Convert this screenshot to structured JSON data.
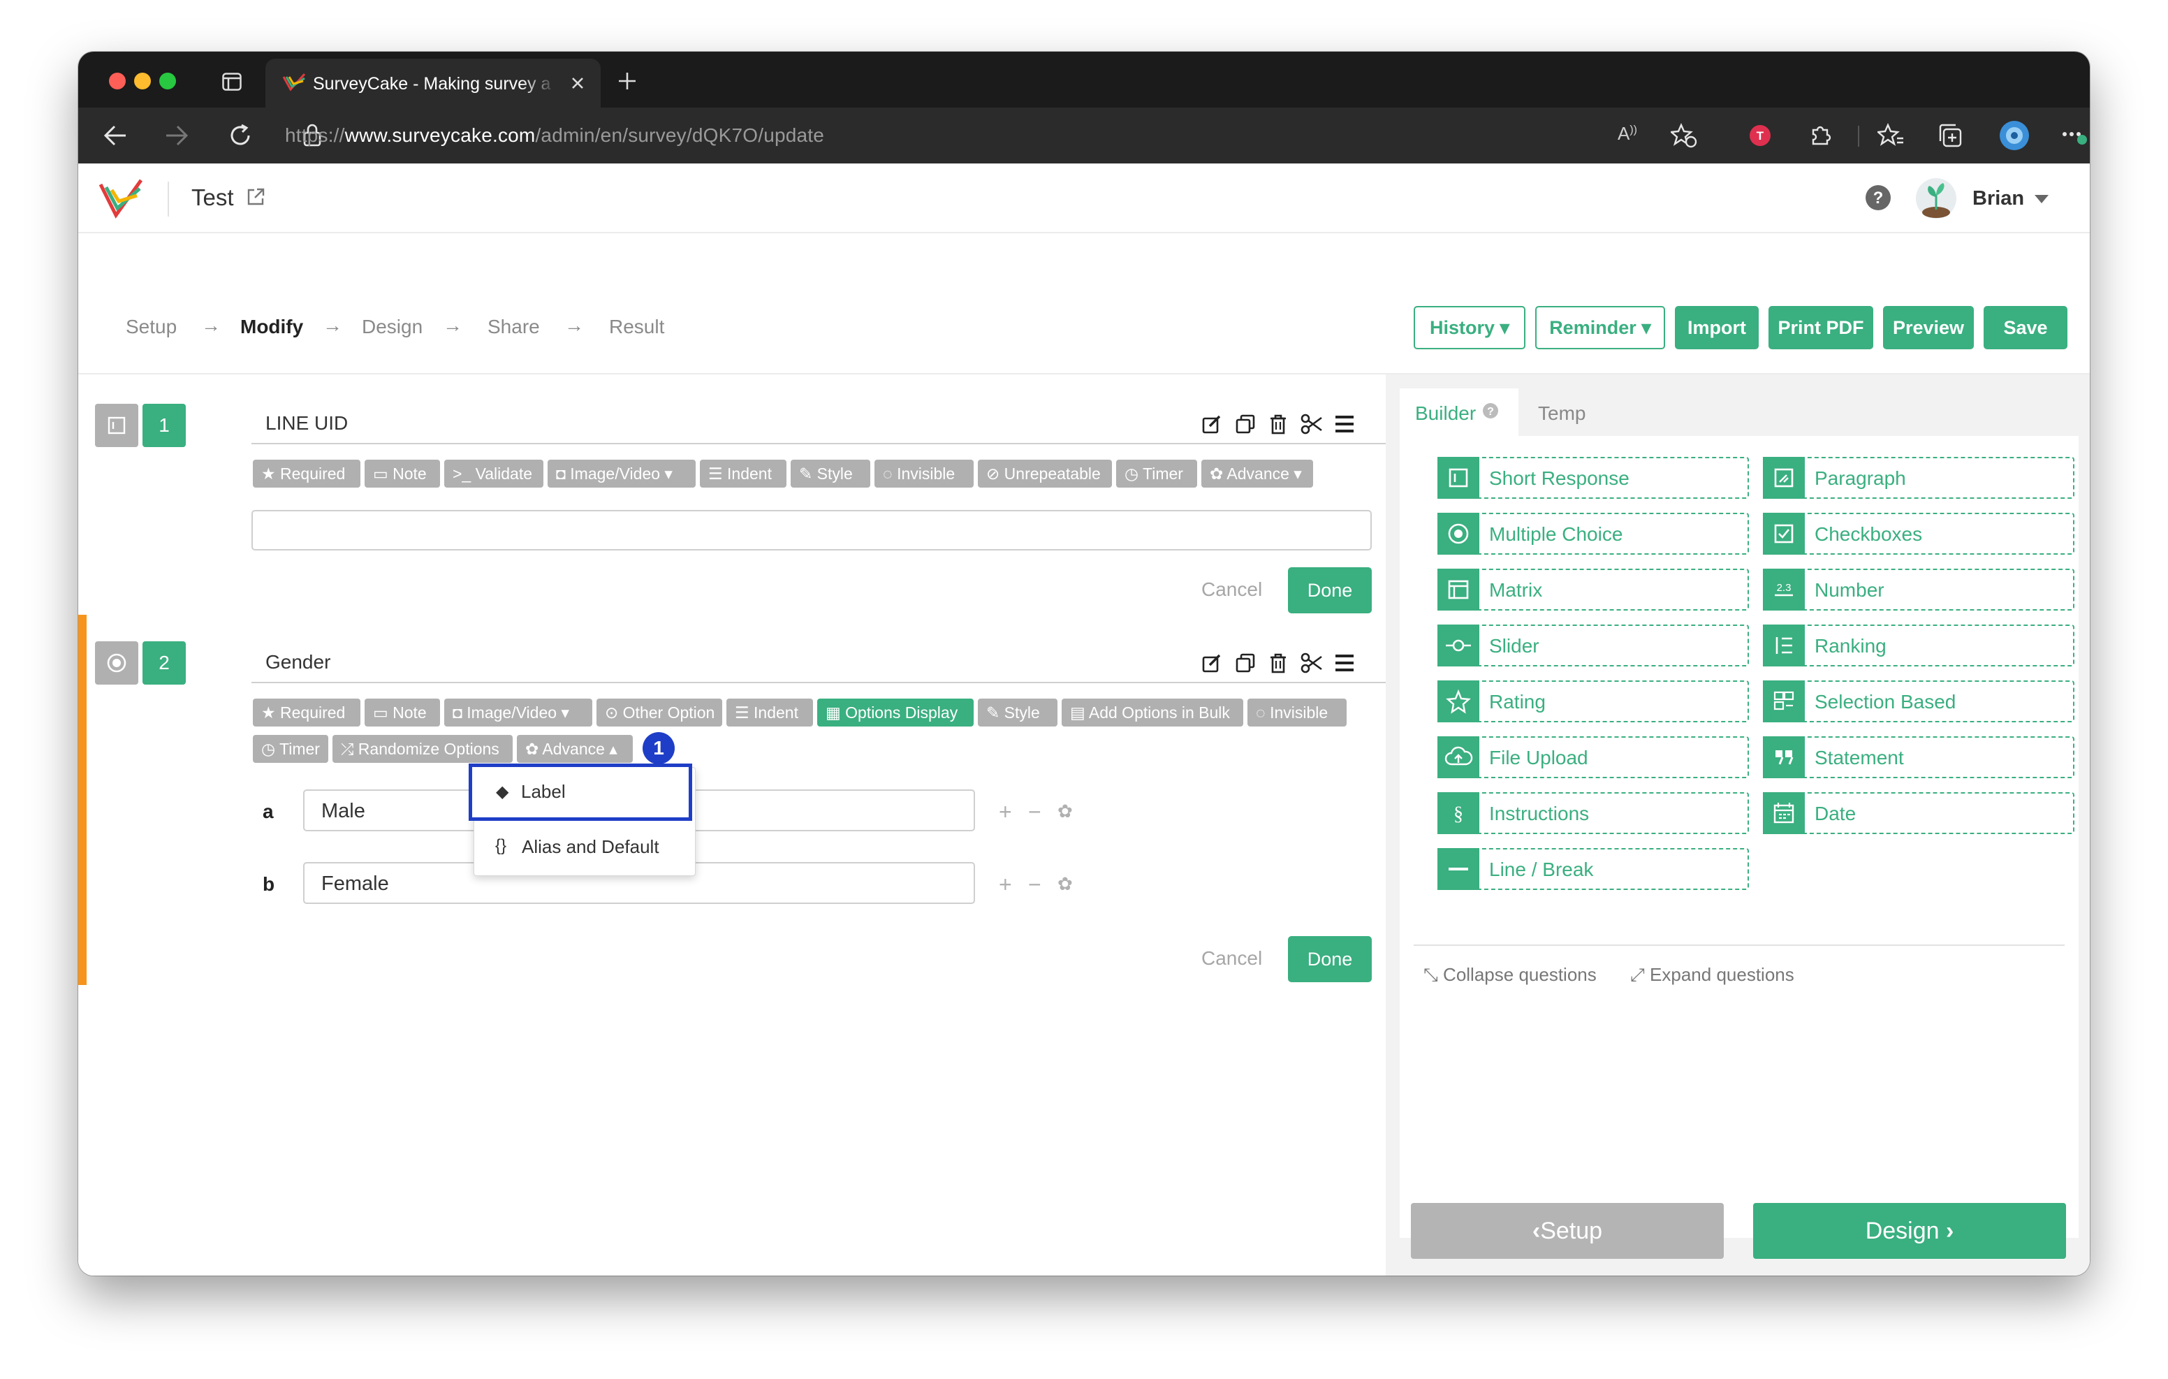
{
  "browser": {
    "tab_title": "SurveyCake - Making survey a",
    "url_prefix": "https://",
    "url_domain": "www.surveycake.com",
    "url_path": "/admin/en/survey/dQK7O/update"
  },
  "header": {
    "survey_title": "Test",
    "user_name": "Brian"
  },
  "steps": [
    "Setup",
    "Modify",
    "Design",
    "Share",
    "Result"
  ],
  "active_step": "Modify",
  "toolbar": {
    "history": "History",
    "reminder": "Reminder",
    "import": "Import",
    "print_pdf": "Print PDF",
    "preview": "Preview",
    "save": "Save"
  },
  "questions": [
    {
      "number": "1",
      "title": "LINE UID",
      "tags": [
        "Required",
        "Note",
        "Validate",
        "Image/Video",
        "Indent",
        "Style",
        "Invisible",
        "Unrepeatable",
        "Timer",
        "Advance"
      ],
      "cancel": "Cancel",
      "done": "Done"
    },
    {
      "number": "2",
      "title": "Gender",
      "tags_row1": [
        "Required",
        "Note",
        "Image/Video",
        "Other Option",
        "Indent",
        "Options Display",
        "Style",
        "Add Options in Bulk",
        "Invisible"
      ],
      "tags_row2": [
        "Timer",
        "Randomize Options",
        "Advance"
      ],
      "callout_badge": "1",
      "options": [
        {
          "key": "a",
          "value": "Male"
        },
        {
          "key": "b",
          "value": "Female"
        }
      ],
      "cancel": "Cancel",
      "done": "Done"
    }
  ],
  "advance_menu": [
    "Label",
    "Alias and Default"
  ],
  "sidebar": {
    "tabs": [
      "Builder",
      "Temp"
    ],
    "items": [
      "Short Response",
      "Paragraph",
      "Multiple Choice",
      "Checkboxes",
      "Matrix",
      "Number",
      "Slider",
      "Ranking",
      "Rating",
      "Selection Based",
      "File Upload",
      "Statement",
      "Instructions",
      "Date",
      "Line / Break"
    ],
    "collapse": "Collapse questions",
    "expand": "Expand questions",
    "prev_step": "Setup",
    "next_step": "Design"
  },
  "colors": {
    "brand_green": "#3aaf80",
    "highlight_blue": "#1f3ec7",
    "active_marker": "#f7941d"
  }
}
